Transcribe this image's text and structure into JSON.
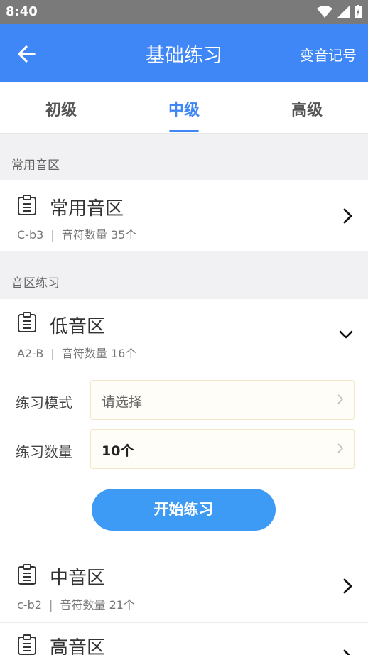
{
  "status": {
    "time": "8:40"
  },
  "header": {
    "title": "基础练习",
    "action": "变音记号"
  },
  "tabs": [
    {
      "label": "初级"
    },
    {
      "label": "中级",
      "active": true
    },
    {
      "label": "高级"
    }
  ],
  "sections": [
    {
      "title": "常用音区",
      "items": [
        {
          "name": "常用音区",
          "range": "C-b3",
          "note_label": "音符数量",
          "count": "35个"
        }
      ]
    },
    {
      "title": "音区练习",
      "items": [
        {
          "name": "低音区",
          "range": "A2-B",
          "note_label": "音符数量",
          "count": "16个",
          "expanded": true,
          "mode_label": "练习模式",
          "mode_placeholder": "请选择",
          "count_label": "练习数量",
          "count_value": "10个",
          "start_label": "开始练习"
        },
        {
          "name": "中音区",
          "range": "c-b2",
          "note_label": "音符数量",
          "count": "21个"
        },
        {
          "name": "高音区"
        }
      ]
    }
  ],
  "colors": {
    "primary": "#3f86f7",
    "button": "#3d9af5"
  }
}
